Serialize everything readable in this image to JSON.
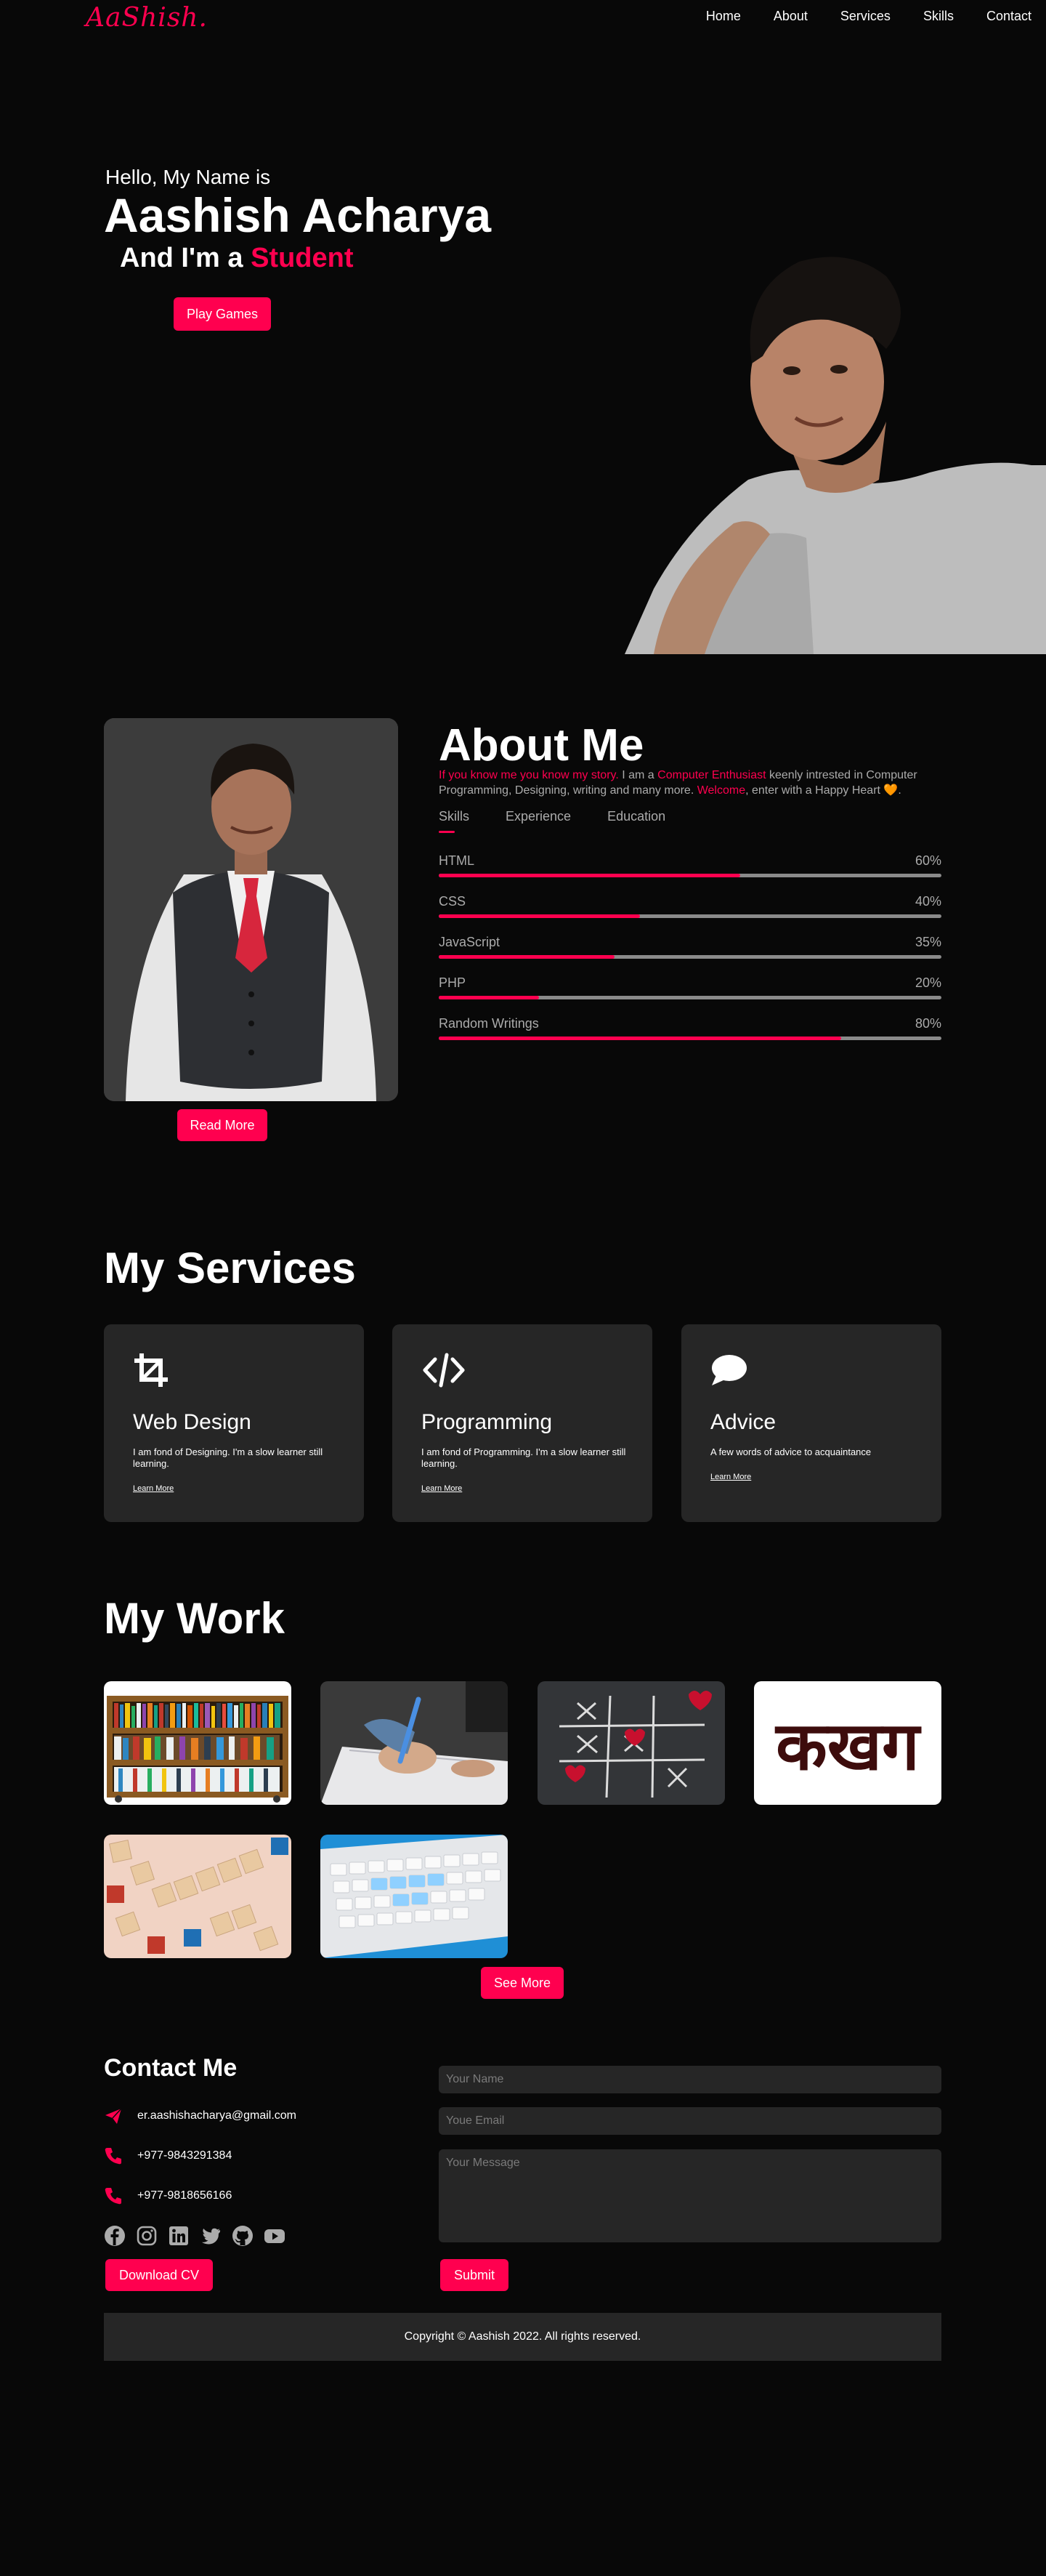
{
  "nav": {
    "logo": "AaShish.",
    "links": [
      "Home",
      "About",
      "Services",
      "Skills",
      "Contact"
    ]
  },
  "hero": {
    "hello": "Hello, My Name is",
    "name": "Aashish Acharya",
    "role_prefix": "And I'm a",
    "role": "Student",
    "cta": "Play Games"
  },
  "about": {
    "title": "About Me",
    "text_1": "If you know me you know my story.",
    "text_2": " I am a ",
    "text_3": "Computer Enthusiast",
    "text_4": " keenly intrested in Computer Programming, Designing, writing and many more. ",
    "text_5": "Welcome",
    "text_6": ", enter with a Happy Heart 🧡.",
    "tabs": [
      "Skills",
      "Experience",
      "Education"
    ],
    "skills": [
      {
        "name": "HTML",
        "pct": "60%",
        "value": 0.6
      },
      {
        "name": "CSS",
        "pct": "40%",
        "value": 0.4
      },
      {
        "name": "JavaScript",
        "pct": "35%",
        "value": 0.35
      },
      {
        "name": "PHP",
        "pct": "20%",
        "value": 0.2
      },
      {
        "name": "Random Writings",
        "pct": "80%",
        "value": 0.8
      }
    ],
    "read_more": "Read More"
  },
  "services": {
    "title": "My Services",
    "items": [
      {
        "icon": "crop-icon",
        "title": "Web Design",
        "desc": "I am fond of Designing. I'm a slow learner still learning.",
        "link": "Learn More"
      },
      {
        "icon": "code-icon",
        "title": "Programming",
        "desc": "I am fond of Programming. I'm a slow learner still learning.",
        "link": "Learn More"
      },
      {
        "icon": "comment-icon",
        "title": "Advice",
        "desc": "A few words of advice to acquaintance",
        "link": "Learn More"
      }
    ]
  },
  "work": {
    "title": "My Work",
    "devanagari": "कखग",
    "see_more": "See More"
  },
  "contact": {
    "title": "Contact Me",
    "email": "er.aashishacharya@gmail.com",
    "phone_1": "+977-9843291384",
    "phone_2": "+977-9818656166",
    "download_cv": "Download CV",
    "name_placeholder": "Your Name",
    "email_placeholder": "Youe Email",
    "message_placeholder": "Your Message",
    "submit": "Submit"
  },
  "footer": {
    "copyright": "Copyright © Aashish 2022. All rights reserved."
  },
  "colors": {
    "accent": "#ff004f",
    "background": "#080808",
    "card": "#262626",
    "muted_text": "#ababab"
  }
}
